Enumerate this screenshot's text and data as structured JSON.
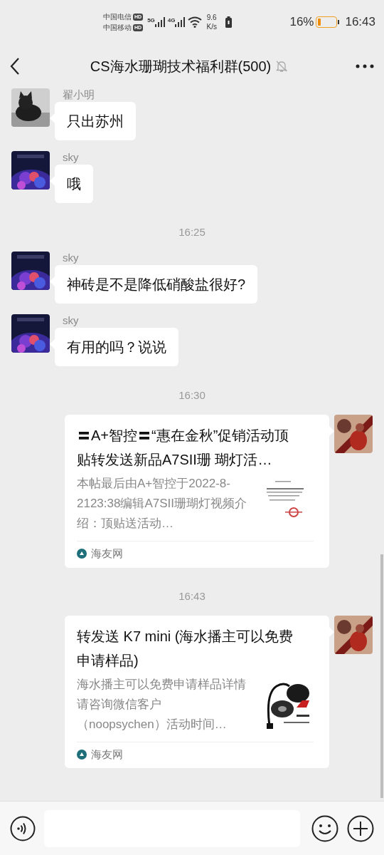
{
  "status_bar": {
    "carriers": [
      {
        "name": "中国电信",
        "badge": "HD"
      },
      {
        "name": "中国移动",
        "badge": "HD"
      }
    ],
    "signals": [
      {
        "label": "5G"
      },
      {
        "label": "4G"
      }
    ],
    "speed": [
      "9.6",
      "K/s"
    ],
    "battery_percent": "16%",
    "battery": {
      "level": 0.16
    },
    "time": "16:43"
  },
  "header": {
    "title": "CS海水珊瑚技术福利群(500)",
    "muted": true
  },
  "messages": [
    {
      "kind": "text",
      "outgoing": false,
      "sender": "翟小明",
      "text": "只出苏州"
    },
    {
      "kind": "text",
      "outgoing": false,
      "sender": "sky",
      "text": "哦"
    },
    {
      "kind": "time",
      "text": "16:25"
    },
    {
      "kind": "text",
      "outgoing": false,
      "sender": "sky",
      "text": "神砖是不是降低硝酸盐很好?"
    },
    {
      "kind": "text",
      "outgoing": false,
      "sender": "sky",
      "text": "有用的吗？说说"
    },
    {
      "kind": "time",
      "text": "16:30"
    },
    {
      "kind": "link",
      "outgoing": true,
      "title": "〓A+智控〓“惠在金秋”促销活动顶贴转发送新品A7SII珊 瑚灯活…",
      "description": "本帖最后由A+智控于2022-8-2123:38编辑A7SII珊瑚灯视频介绍：顶贴送活动…",
      "source": "海友网"
    },
    {
      "kind": "time",
      "text": "16:43"
    },
    {
      "kind": "link",
      "outgoing": true,
      "title": "转发送 K7 mini (海水播主可以免费申请样品)",
      "description": "海水播主可以免费申请样品详情请咨询微信客户（noopsychen）活动时间…",
      "source": "海友网"
    }
  ]
}
